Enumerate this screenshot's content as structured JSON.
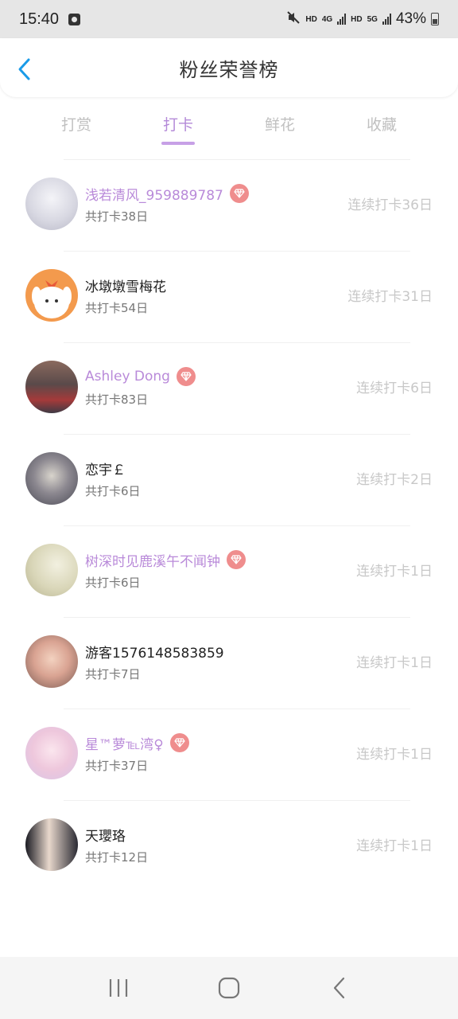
{
  "status_bar": {
    "time": "15:40",
    "net1": "HD",
    "net2_gen": "4G",
    "net3": "HD",
    "net4_gen": "5G",
    "battery": "43%"
  },
  "header": {
    "title": "粉丝荣誉榜",
    "back_icon": "chevron-left-icon",
    "accent_color": "#1a9be8"
  },
  "tabs": [
    {
      "label": "打赏",
      "active": false
    },
    {
      "label": "打卡",
      "active": true
    },
    {
      "label": "鲜花",
      "active": false
    },
    {
      "label": "收藏",
      "active": false
    }
  ],
  "colors": {
    "active_tab": "#b48ad8",
    "vip_name": "#b98ad9",
    "vip_badge": "#ef8d8d"
  },
  "fans": [
    {
      "name": "浅若清风_959889787",
      "vip": true,
      "total": "共打卡38日",
      "streak": "连续打卡36日"
    },
    {
      "name": "冰墩墩雪梅花",
      "vip": false,
      "total": "共打卡54日",
      "streak": "连续打卡31日"
    },
    {
      "name": "Ashley Dong",
      "vip": true,
      "total": "共打卡83日",
      "streak": "连续打卡6日"
    },
    {
      "name": "恋宇￡",
      "vip": false,
      "total": "共打卡6日",
      "streak": "连续打卡2日"
    },
    {
      "name": "树深时见鹿溪午不闻钟",
      "vip": true,
      "total": "共打卡6日",
      "streak": "连续打卡1日"
    },
    {
      "name": "游客1576148583859",
      "vip": false,
      "total": "共打卡7日",
      "streak": "连续打卡1日"
    },
    {
      "name": "星™萝℡湾♀",
      "vip": true,
      "total": "共打卡37日",
      "streak": "连续打卡1日"
    },
    {
      "name": "天瓔珞",
      "vip": false,
      "total": "共打卡12日",
      "streak": "连续打卡1日"
    }
  ],
  "nav_bar": {
    "recents_icon": "recent-apps-icon",
    "home_icon": "home-icon",
    "back_icon": "back-icon"
  }
}
